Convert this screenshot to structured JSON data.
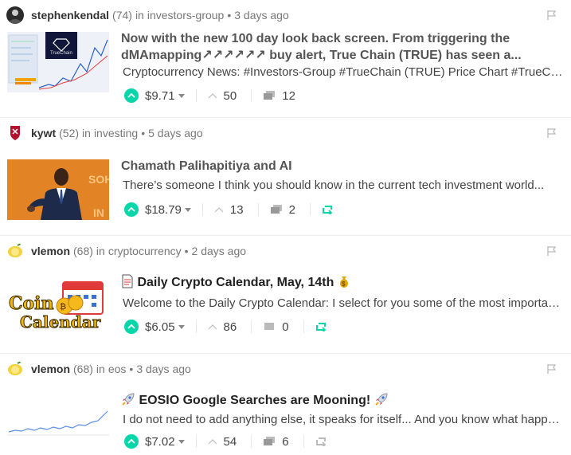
{
  "colors": {
    "accent": "#06d6a9",
    "text": "#333333",
    "muted": "#777777"
  },
  "posts": [
    {
      "author": "stephenkendal",
      "reputation": "(74)",
      "in_word": "in",
      "community": "investors-group",
      "time": "3 days ago",
      "title": "Now with the new 100 day look back screen. From triggering the dMAmapping↗↗↗↗↗↗ buy alert, True Chain (TRUE) has seen a...",
      "body": "Cryptocurrency News: #Investors-Group #TrueChain (TRUE) Price Chart #TrueChain",
      "payout": "$9.71",
      "votes": "50",
      "comments": "12",
      "thumbnail_label": "TrueChain",
      "avatar_icon": "user-photo-avatar",
      "has_resteem": false
    },
    {
      "author": "kywt",
      "reputation": "(52)",
      "in_word": "in",
      "community": "investing",
      "time": "5 days ago",
      "title": "Chamath Palihapitiya and AI",
      "body": "There’s someone I think you should know in the current tech investment world...",
      "payout": "$18.79",
      "votes": "13",
      "comments": "2",
      "avatar_icon": "red-shield-avatar",
      "has_resteem": true
    },
    {
      "author": "vlemon",
      "reputation": "(68)",
      "in_word": "in",
      "community": "cryptocurrency",
      "time": "2 days ago",
      "title": "Daily Crypto Calendar, May, 14th",
      "body": "Welcome to the Daily Crypto Calendar: I select for you some of the most important...",
      "payout": "$6.05",
      "votes": "86",
      "comments": "0",
      "thumbnail_text_1": "Coin",
      "thumbnail_text_2": "Calendar",
      "avatar_icon": "lemon-avatar",
      "has_resteem": true
    },
    {
      "author": "vlemon",
      "reputation": "(68)",
      "in_word": "in",
      "community": "eos",
      "time": "3 days ago",
      "title": "EOSIO Google Searches are Mooning!",
      "body": "I do not need to add anything else, it speaks for itself... And you know what happens next...",
      "payout": "$7.02",
      "votes": "54",
      "comments": "6",
      "avatar_icon": "lemon-avatar",
      "has_resteem": true
    }
  ]
}
